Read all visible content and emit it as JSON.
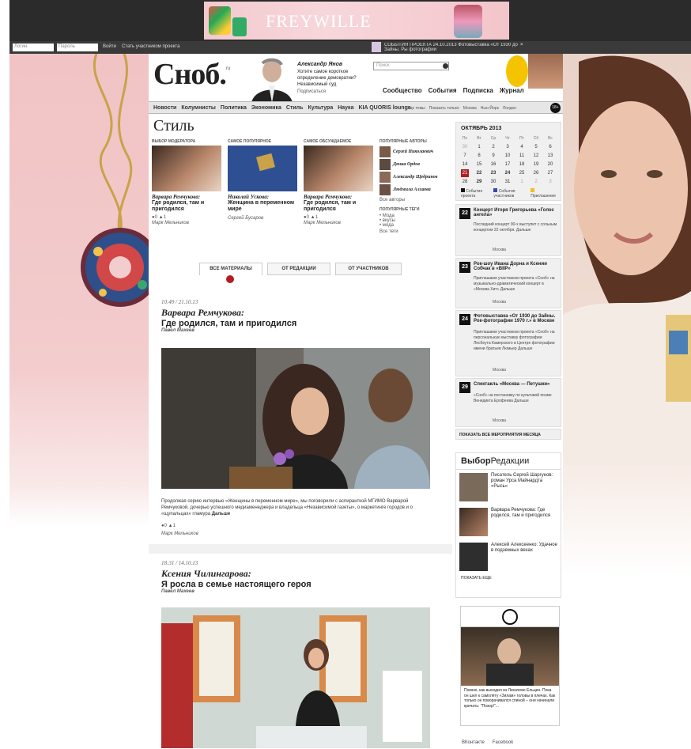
{
  "banner": {
    "brand": "FREYWILLE"
  },
  "toolbar": {
    "login_placeholder": "Логин",
    "password_placeholder": "Пароль",
    "enter_label": "Войти",
    "join_label": "Стать участником проекта",
    "notice": "СОБЫТИЯ ПРОЕКТА 24.10.2013 Фотовыставка «От 1930 до Зайны. Ры фотографии"
  },
  "header": {
    "logo": "Сноб.",
    "logo_sup": "ru",
    "promo_name": "Александр Янов",
    "promo_text": "Хотите самое короткое определение демократии? Независимый суд",
    "promo_link": "Подписаться",
    "search_placeholder": "Поиск",
    "mainnav": [
      "Сообщество",
      "События",
      "Подписка",
      "Журнал"
    ]
  },
  "subnav": {
    "items": [
      "Новости",
      "Колумнисты",
      "Политика",
      "Экономика",
      "Стиль",
      "Культура",
      "Наука",
      "KIA QUORIS lounge"
    ],
    "extra": [
      "Еще темы",
      "Показать только",
      "Москва",
      "Нью-Йорк",
      "Лондон"
    ]
  },
  "section_title": "Стиль",
  "cards": [
    {
      "label": "ВЫБОР МОДЕРАТОРА",
      "author": "Варвара Ремчукова:",
      "title": "Где родился, там и пригодился",
      "byline": "Марк Мельников",
      "counts": [
        "0",
        "1"
      ]
    },
    {
      "label": "САМОЕ ПОПУЛЯРНОЕ",
      "author": "Николай Ускова:",
      "title": "Женщина в переменном мире",
      "byline": "Сергей Бусаров",
      "counts": [
        "",
        ""
      ]
    },
    {
      "label": "САМОЕ ОБСУЖДАЕМОЕ",
      "author": "Варвара Ремчукова:",
      "title": "Где родился, там и пригодился",
      "byline": "Марк Мельников",
      "counts": [
        "0",
        "1"
      ]
    }
  ],
  "popular_authors": {
    "label": "ПОПУЛЯРНЫЕ АВТОРЫ",
    "names": [
      "Сергей Николаевич",
      "Дюша Ордов",
      "Александр Щедринов",
      "Людмила Алхаева"
    ],
    "all": "Все авторы"
  },
  "popular_tags": {
    "label": "ПОПУЛЯРНЫЕ ТЕГИ",
    "tags": [
      "Мода",
      "вкусы",
      "мода"
    ],
    "all": "Все теги"
  },
  "tabs": [
    "ВСЕ МАТЕРИАЛЫ",
    "ОТ РЕДАКЦИИ",
    "ОТ УЧАСТНИКОВ"
  ],
  "articles": [
    {
      "time": "10:49 / 21.10.13",
      "author": "Варвара Ремчукова:",
      "title": "Где родился, там и пригодился",
      "byline": "Павел Махеев",
      "excerpt": "Продолжая серию интервью «Женщины в переменном мире», мы поговорили с аспиранткой МГИМО Варварой Ремчуковой, дочерью успешного медиаменеджера и владельца «Независимой газеты», о маркетинге городов и о «щупальцах» гламура",
      "more": "Дальше",
      "counts": [
        "0",
        "1"
      ],
      "footer": "Марк Мельников"
    },
    {
      "time": "18:31 / 14.10.13",
      "author": "Ксения Чилингарова:",
      "title": "Я росла в семье настоящего героя",
      "byline": "Павел Махеев"
    }
  ],
  "calendar": {
    "month": "ОКТЯБРЬ 2013",
    "weekdays": [
      "Пн",
      "Вт",
      "Ср",
      "Чт",
      "Пт",
      "Сб",
      "Вс"
    ],
    "days": [
      "30",
      "1",
      "2",
      "3",
      "4",
      "5",
      "6",
      "7",
      "8",
      "9",
      "10",
      "11",
      "12",
      "13",
      "14",
      "15",
      "16",
      "17",
      "18",
      "19",
      "20",
      "21",
      "22",
      "23",
      "24",
      "25",
      "26",
      "27",
      "28",
      "29",
      "30",
      "31",
      "1",
      "2",
      "3"
    ],
    "legend": [
      "События проекта",
      "События участников",
      "Приглашение"
    ]
  },
  "events": [
    {
      "day": "22",
      "title": "Концерт Игоря Григорьева «Голос ангела»",
      "desc": "Последний концерт 90-х выступит с сольным концертом 22 октября. Дальше",
      "place": "Москва"
    },
    {
      "day": "23",
      "title": "Рок-шоу Ивана Дорна и Ксении Собчак в «BIIP»",
      "desc": "Приглашаем участников проекта «Сноб» на музыкально-драматический концерт в «Москва Хит» Дальше",
      "place": "Москва"
    },
    {
      "day": "24",
      "title": "Фотовыставка «От 1930 до Зайны. Рок-фотографии 1970 г.» в Москве",
      "desc": "Приглашаем участников проекта «Сноб» на персональную выставку фотографии Лесбеута Камерского в Центре фотографии имени братьев Люмьер Дальше",
      "place": "Москва"
    },
    {
      "day": "29",
      "title": "Спектакль «Москва — Петушки»",
      "desc": "«Сноб» на постановку по культовой поэме Венедикта Ерофеева Дальше",
      "place": "Москва"
    }
  ],
  "events_more": "ПОКАЗАТЬ ВСЕ МЕРОПРИЯТИЯ МЕСЯЦА",
  "editors_choice": {
    "title_bold": "Выбор",
    "title_rest": "Редакции",
    "items": [
      {
        "text": "Писатель Сергей Шаргунов: роман Урса Майнардта «Рысь»"
      },
      {
        "text": "Варвара Ремчукова: Где родился, там и пригодился"
      },
      {
        "text": "Алексей Алексеенко: Удачное в подземных вехах"
      }
    ],
    "more": "ПОКАЗАТЬ ЕЩЕ"
  },
  "quote": {
    "caption": "Помню, как выходил из Лихачево Ельцин. Пока он шел к самолёту «Зилам» головы в плечах. Как только он поворачивался спиной – они начинали кричать: \"Позор!\"..."
  },
  "social": [
    "ВКонтакте",
    "Facebook"
  ],
  "colors": {
    "accent": "#b01e23",
    "nav_bg": "#e6e6e6",
    "toolbar_bg": "#3a3a3a",
    "banner_bg": "#2b2b2b"
  }
}
